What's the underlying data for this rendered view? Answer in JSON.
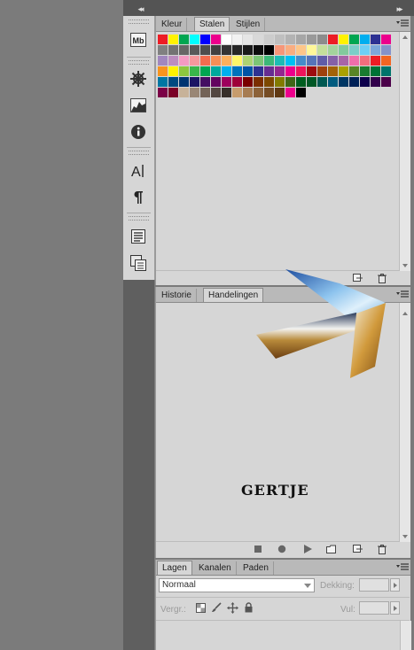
{
  "colors": {
    "workspace": "#7b7b7b",
    "panel_bg": "#d6d6d6",
    "tab_bar": "#b9b9b9"
  },
  "top": {
    "collapse_label": "◂◂",
    "expand_label": "▸▸"
  },
  "iconbar": {
    "icons": [
      "mini-bridge-icon",
      "navigator-wheel-icon",
      "histogram-icon",
      "info-icon",
      "character-icon",
      "paragraph-icon",
      "notes-icon",
      "clone-source-icon"
    ]
  },
  "swatches_panel": {
    "tabs": [
      {
        "label": "Kleur",
        "active": false
      },
      {
        "label": "Stalen",
        "active": true
      },
      {
        "label": "Stijlen",
        "active": false
      }
    ],
    "rows": [
      [
        "#ed1c24",
        "#fff200",
        "#00a651",
        "#00ffff",
        "#0000ff",
        "#ec008c",
        "#ffffff",
        "#f2f2f2",
        "#e6e6e6",
        "#d9d9d9",
        "#cccccc",
        "#bfbfbf",
        "#b3b3b3",
        "#a6a6a6",
        "#999999",
        "#8c8c8c",
        "#ed1c24",
        "#fff200",
        "#00a651",
        "#00aeef",
        "#2e3192",
        "#ec008c"
      ],
      [
        "#808080",
        "#737373",
        "#666666",
        "#595959",
        "#4d4d4d",
        "#404040",
        "#333333",
        "#262626",
        "#1a1a1a",
        "#0d0d0d",
        "#000000",
        "#f69679",
        "#f9ad81",
        "#fdc689",
        "#fff799",
        "#c4df9b",
        "#a3d39c",
        "#82ca9d",
        "#7bcdc8",
        "#6dcff6",
        "#7da7d9",
        "#8493ca"
      ],
      [
        "#a187be",
        "#bc8dbf",
        "#f49ac2",
        "#f6989d",
        "#f26c4f",
        "#f68e56",
        "#fbaf5d",
        "#fff568",
        "#acd373",
        "#7cc576",
        "#3cb878",
        "#1cbbb4",
        "#00bff3",
        "#448ccb",
        "#5574b9",
        "#605ca8",
        "#8560a8",
        "#a864a8",
        "#f06eaa",
        "#f26d7d",
        "#ed1c24",
        "#f26522"
      ],
      [
        "#f7941d",
        "#fff200",
        "#8dc63f",
        "#39b54a",
        "#00a651",
        "#00a99d",
        "#00aeef",
        "#0072bc",
        "#0054a6",
        "#2e3192",
        "#662d91",
        "#92278f",
        "#ec008c",
        "#ed145b",
        "#9e0b0f",
        "#a0410d",
        "#a36209",
        "#aba000",
        "#598527",
        "#197b30",
        "#007236",
        "#00746b"
      ],
      [
        "#0076a3",
        "#004a80",
        "#003471",
        "#1b1464",
        "#440e62",
        "#630460",
        "#9e005d",
        "#9e0039",
        "#790000",
        "#7b2e00",
        "#7d4900",
        "#827b00",
        "#406618",
        "#005e20",
        "#005826",
        "#005952",
        "#005b7f",
        "#003663",
        "#002157",
        "#0d004c",
        "#32004b",
        "#4b0049"
      ],
      [
        "#7b0046",
        "#7a0026",
        "#c7b299",
        "#998675",
        "#736357",
        "#534741",
        "#37302a",
        "#c69c6d",
        "#a67c52",
        "#8c6239",
        "#754c24",
        "#603913",
        "#ec008c",
        "#000000"
      ]
    ]
  },
  "actions_panel": {
    "tabs": [
      {
        "label": "Historie",
        "active": false
      },
      {
        "label": "Handelingen",
        "active": true
      }
    ],
    "watermark": "GERTJE"
  },
  "layers_panel": {
    "tabs": [
      {
        "label": "Lagen",
        "active": true
      },
      {
        "label": "Kanalen",
        "active": false
      },
      {
        "label": "Paden",
        "active": false
      }
    ],
    "blend_mode": "Normaal",
    "opacity_label": "Dekking:",
    "lock_label": "Vergr.:",
    "fill_label": "Vul:"
  }
}
